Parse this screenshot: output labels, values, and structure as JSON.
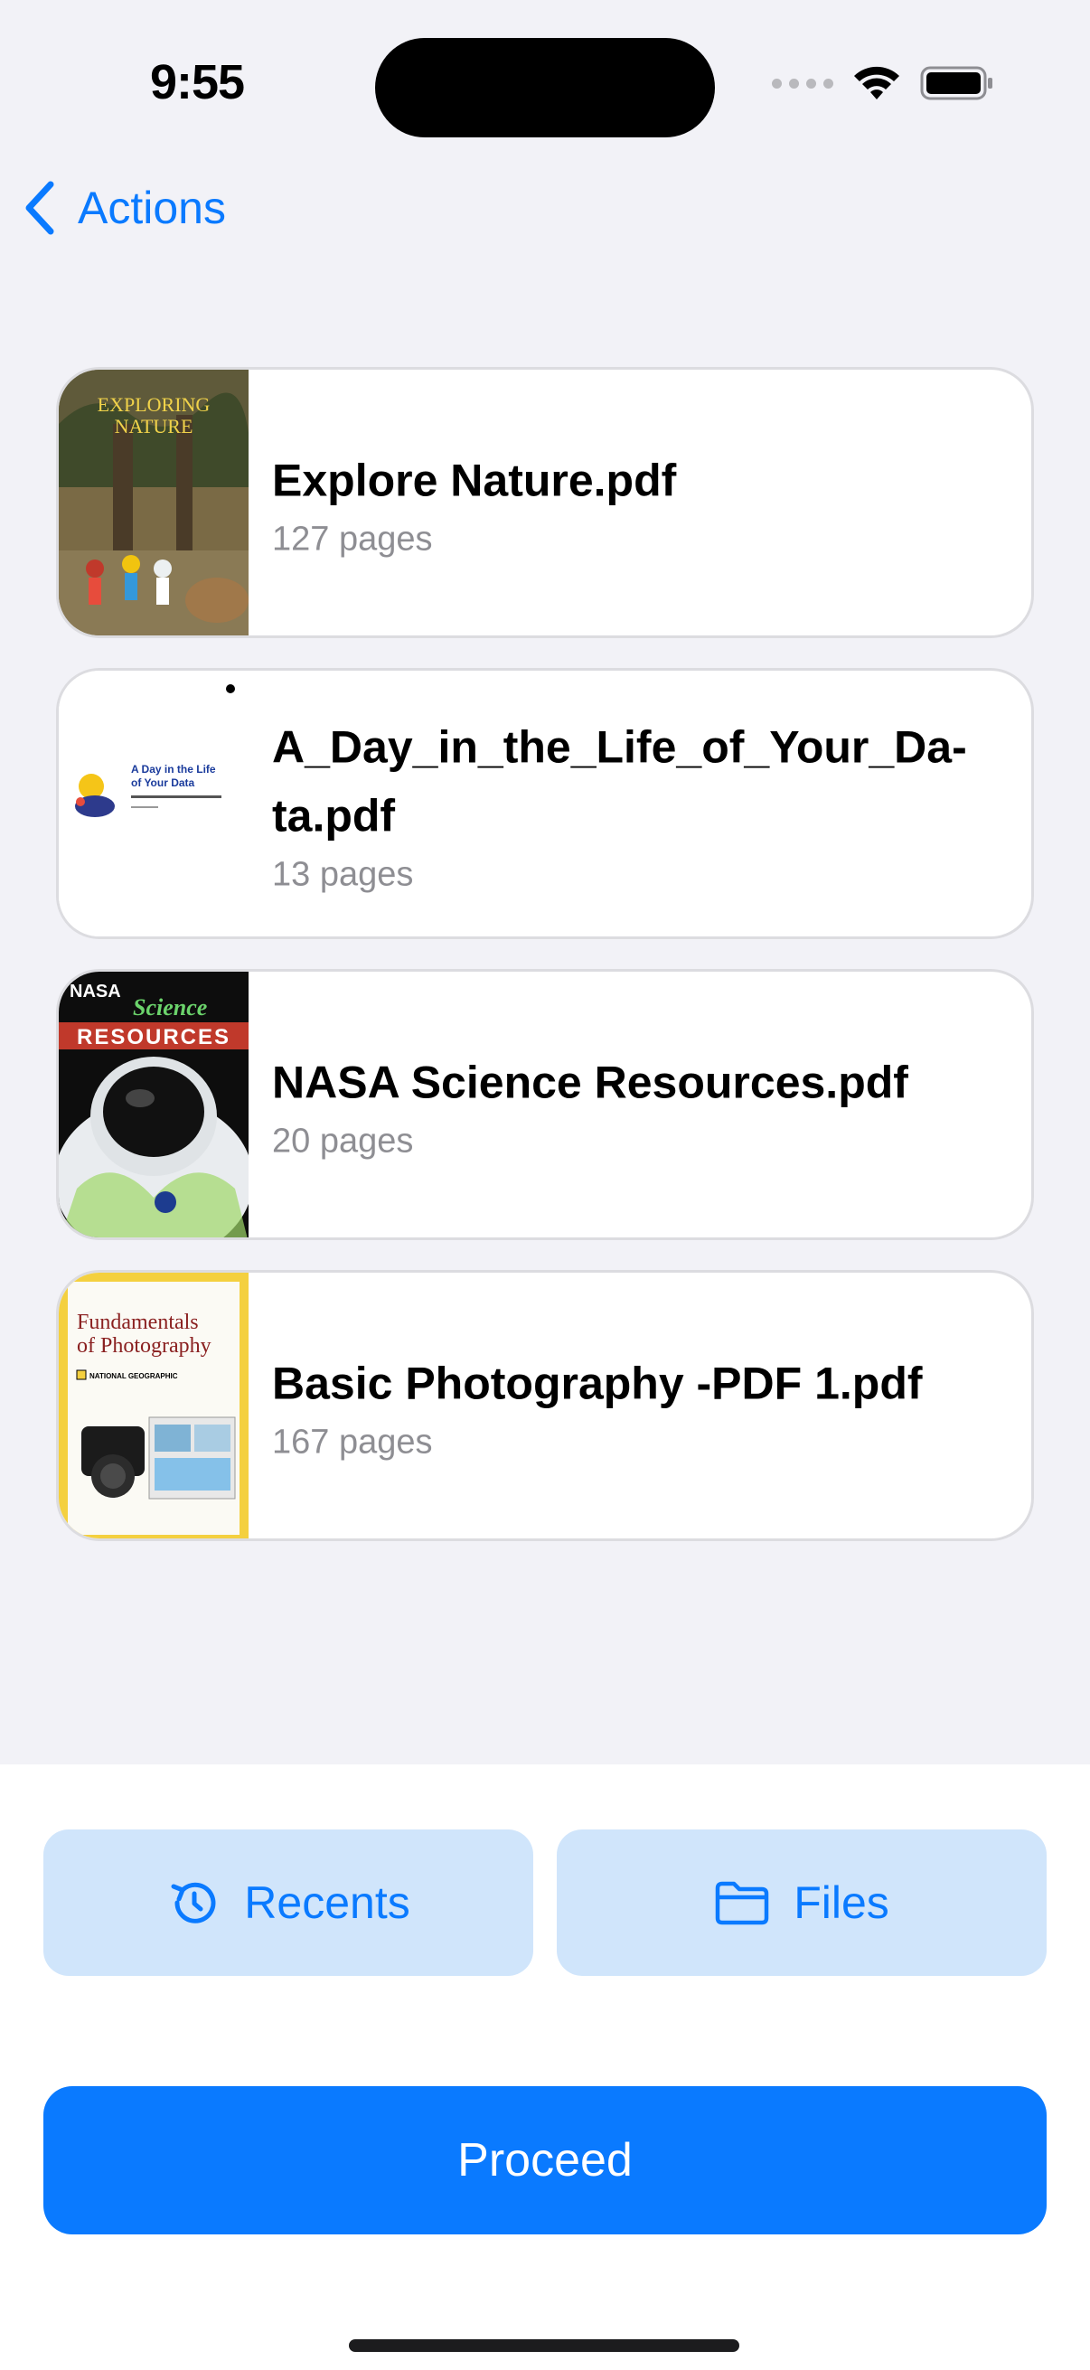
{
  "status_bar": {
    "time": "9:55"
  },
  "nav": {
    "back_label": "Actions"
  },
  "documents": [
    {
      "title": "Explore Nature.pdf",
      "pages": "127 pages",
      "cover_lines": [
        "EXPLORING",
        "NATURE"
      ]
    },
    {
      "title": "A_Day_in_the_Life_of_Your_Da-ta.pdf",
      "pages": "13 pages",
      "cover_lines": [
        "A Day in the Life",
        "of Your Data"
      ]
    },
    {
      "title": "NASA Science Resources.pdf",
      "pages": "20 pages",
      "cover_lines": [
        "NASA",
        "Science",
        "RESOURCES"
      ]
    },
    {
      "title": "Basic Photography -PDF 1.pdf",
      "pages": "167 pages",
      "cover_lines": [
        "Fundamentals",
        "of Photography",
        "NATIONAL GEOGRAPHIC"
      ]
    }
  ],
  "buttons": {
    "recents": "Recents",
    "files": "Files",
    "proceed": "Proceed"
  },
  "colors": {
    "accent": "#0a7aff",
    "pill_bg": "#d0e5fb",
    "background": "#f2f2f7"
  }
}
